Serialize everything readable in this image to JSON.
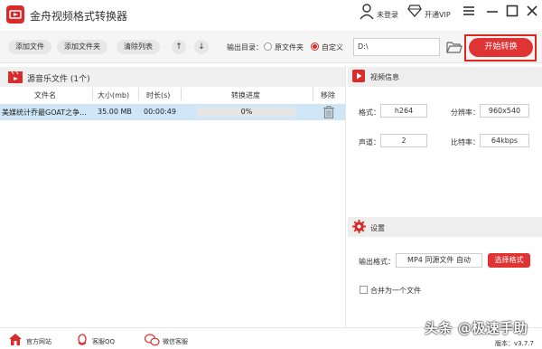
{
  "app": {
    "title": "金舟视频格式转换器"
  },
  "titlebar": {
    "login": "未登录",
    "vip": "开通VIP"
  },
  "toolbar": {
    "add_file": "添加文件",
    "add_folder": "添加文件夹",
    "clear_list": "清除列表",
    "up": "↑",
    "down": "↓",
    "output_label": "输出目录：",
    "opt_source": "原文件夹",
    "opt_custom": "自定义",
    "output_path": "D:\\",
    "start": "开始转换"
  },
  "file_list": {
    "header": "源音乐文件 (1个)",
    "columns": [
      "文件名",
      "大小(mb)",
      "时长(s)",
      "转换进度",
      "移除"
    ],
    "rows": [
      {
        "name": "美媒统计乔最GOAT之争...",
        "size": "35.00 MB",
        "duration": "00:00:49",
        "progress_text": "0%",
        "progress": 0
      }
    ]
  },
  "video_info": {
    "title": "视频信息",
    "format_label": "格式：",
    "format": "h264",
    "resolution_label": "分辨率：",
    "resolution": "960x540",
    "channel_label": "声道：",
    "channel": "2",
    "bitrate_label": "比特率：",
    "bitrate": "64kbps"
  },
  "settings": {
    "title": "设置",
    "output_format_label": "输出格式：",
    "output_format": "MP4 同源文件 自动",
    "select_format": "选择格式",
    "merge": "合并为一个文件"
  },
  "bottom": {
    "website": "官方网站",
    "qq": "客服QQ",
    "wechat": "微信客服",
    "version": "版本：v3.7.7"
  },
  "watermark": "头条 @极速手助",
  "colors": {
    "accent": "#e03333",
    "selected_row": "#cfe6f7"
  }
}
